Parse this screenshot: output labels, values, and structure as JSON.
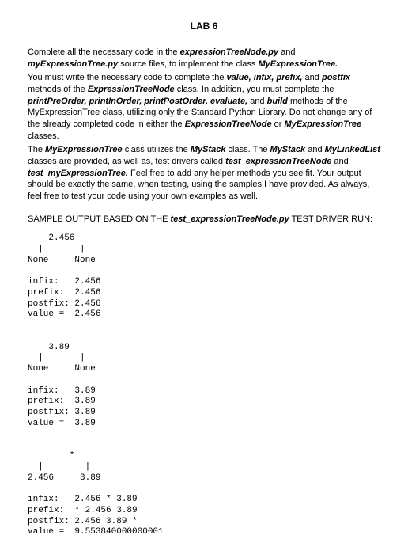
{
  "title": "LAB 6",
  "paragraphs": {
    "p1a": "Complete all the necessary code in the ",
    "p1b": "expressionTreeNode.py",
    "p1c": " and ",
    "p1d": "myExpressionTree.py",
    "p1e": " source files, to implement the class ",
    "p1f": "MyExpressionTree.",
    "p2a": "You must write the necessary code to complete the ",
    "p2b": "value, infix, prefix,",
    "p2c": " and ",
    "p2d": "postfix",
    "p2e": " methods of the ",
    "p2f": "ExpressionTreeNode",
    "p2g": " class. In addition, you must complete the ",
    "p2h": "printPreOrder, printInOrder, printPostOrder, evaluate,",
    "p2i": " and ",
    "p2j": "build",
    "p2k": " methods of the MyExpressionTree class, ",
    "p2l": "utilizing only the Standard Python Library.",
    "p2m": " Do not change any of the already completed code in either the ",
    "p2n": "ExpressionTreeNode",
    "p2o": " or ",
    "p2p": "MyExpressionTree",
    "p2q": " classes.",
    "p3a": "The ",
    "p3b": "MyExpressionTree",
    "p3c": " class utilizes the ",
    "p3d": "MyStack",
    "p3e": " class. The ",
    "p3f": "MyStack",
    "p3g": " and ",
    "p3h": "MyLinkedList",
    "p3i": " classes are provided, as well as, test drivers called ",
    "p3j": "test_expressionTreeNode",
    "p3k": " and ",
    "p3l": "test_myExpressionTree.",
    "p3m": " Feel free to add any helper methods you see fit. Your output should be exactly the same, when testing, using the samples I have provided. As always, feel free to test your code using your own examples as well.",
    "sample_header_a": "SAMPLE OUTPUT BASED ON THE ",
    "sample_header_b": "test_expressionTreeNode.py",
    "sample_header_c": " TEST DRIVER RUN:"
  },
  "output": "    2.456\n  |       |\nNone     None\n\ninfix:   2.456\nprefix:  2.456\npostfix: 2.456\nvalue =  2.456\n\n\n    3.89\n  |       |\nNone     None\n\ninfix:   3.89\nprefix:  3.89\npostfix: 3.89\nvalue =  3.89\n\n\n        *\n  |        |\n2.456     3.89\n\ninfix:   2.456 * 3.89\nprefix:  * 2.456 3.89\npostfix: 2.456 3.89 *\nvalue =  9.553840000000001"
}
